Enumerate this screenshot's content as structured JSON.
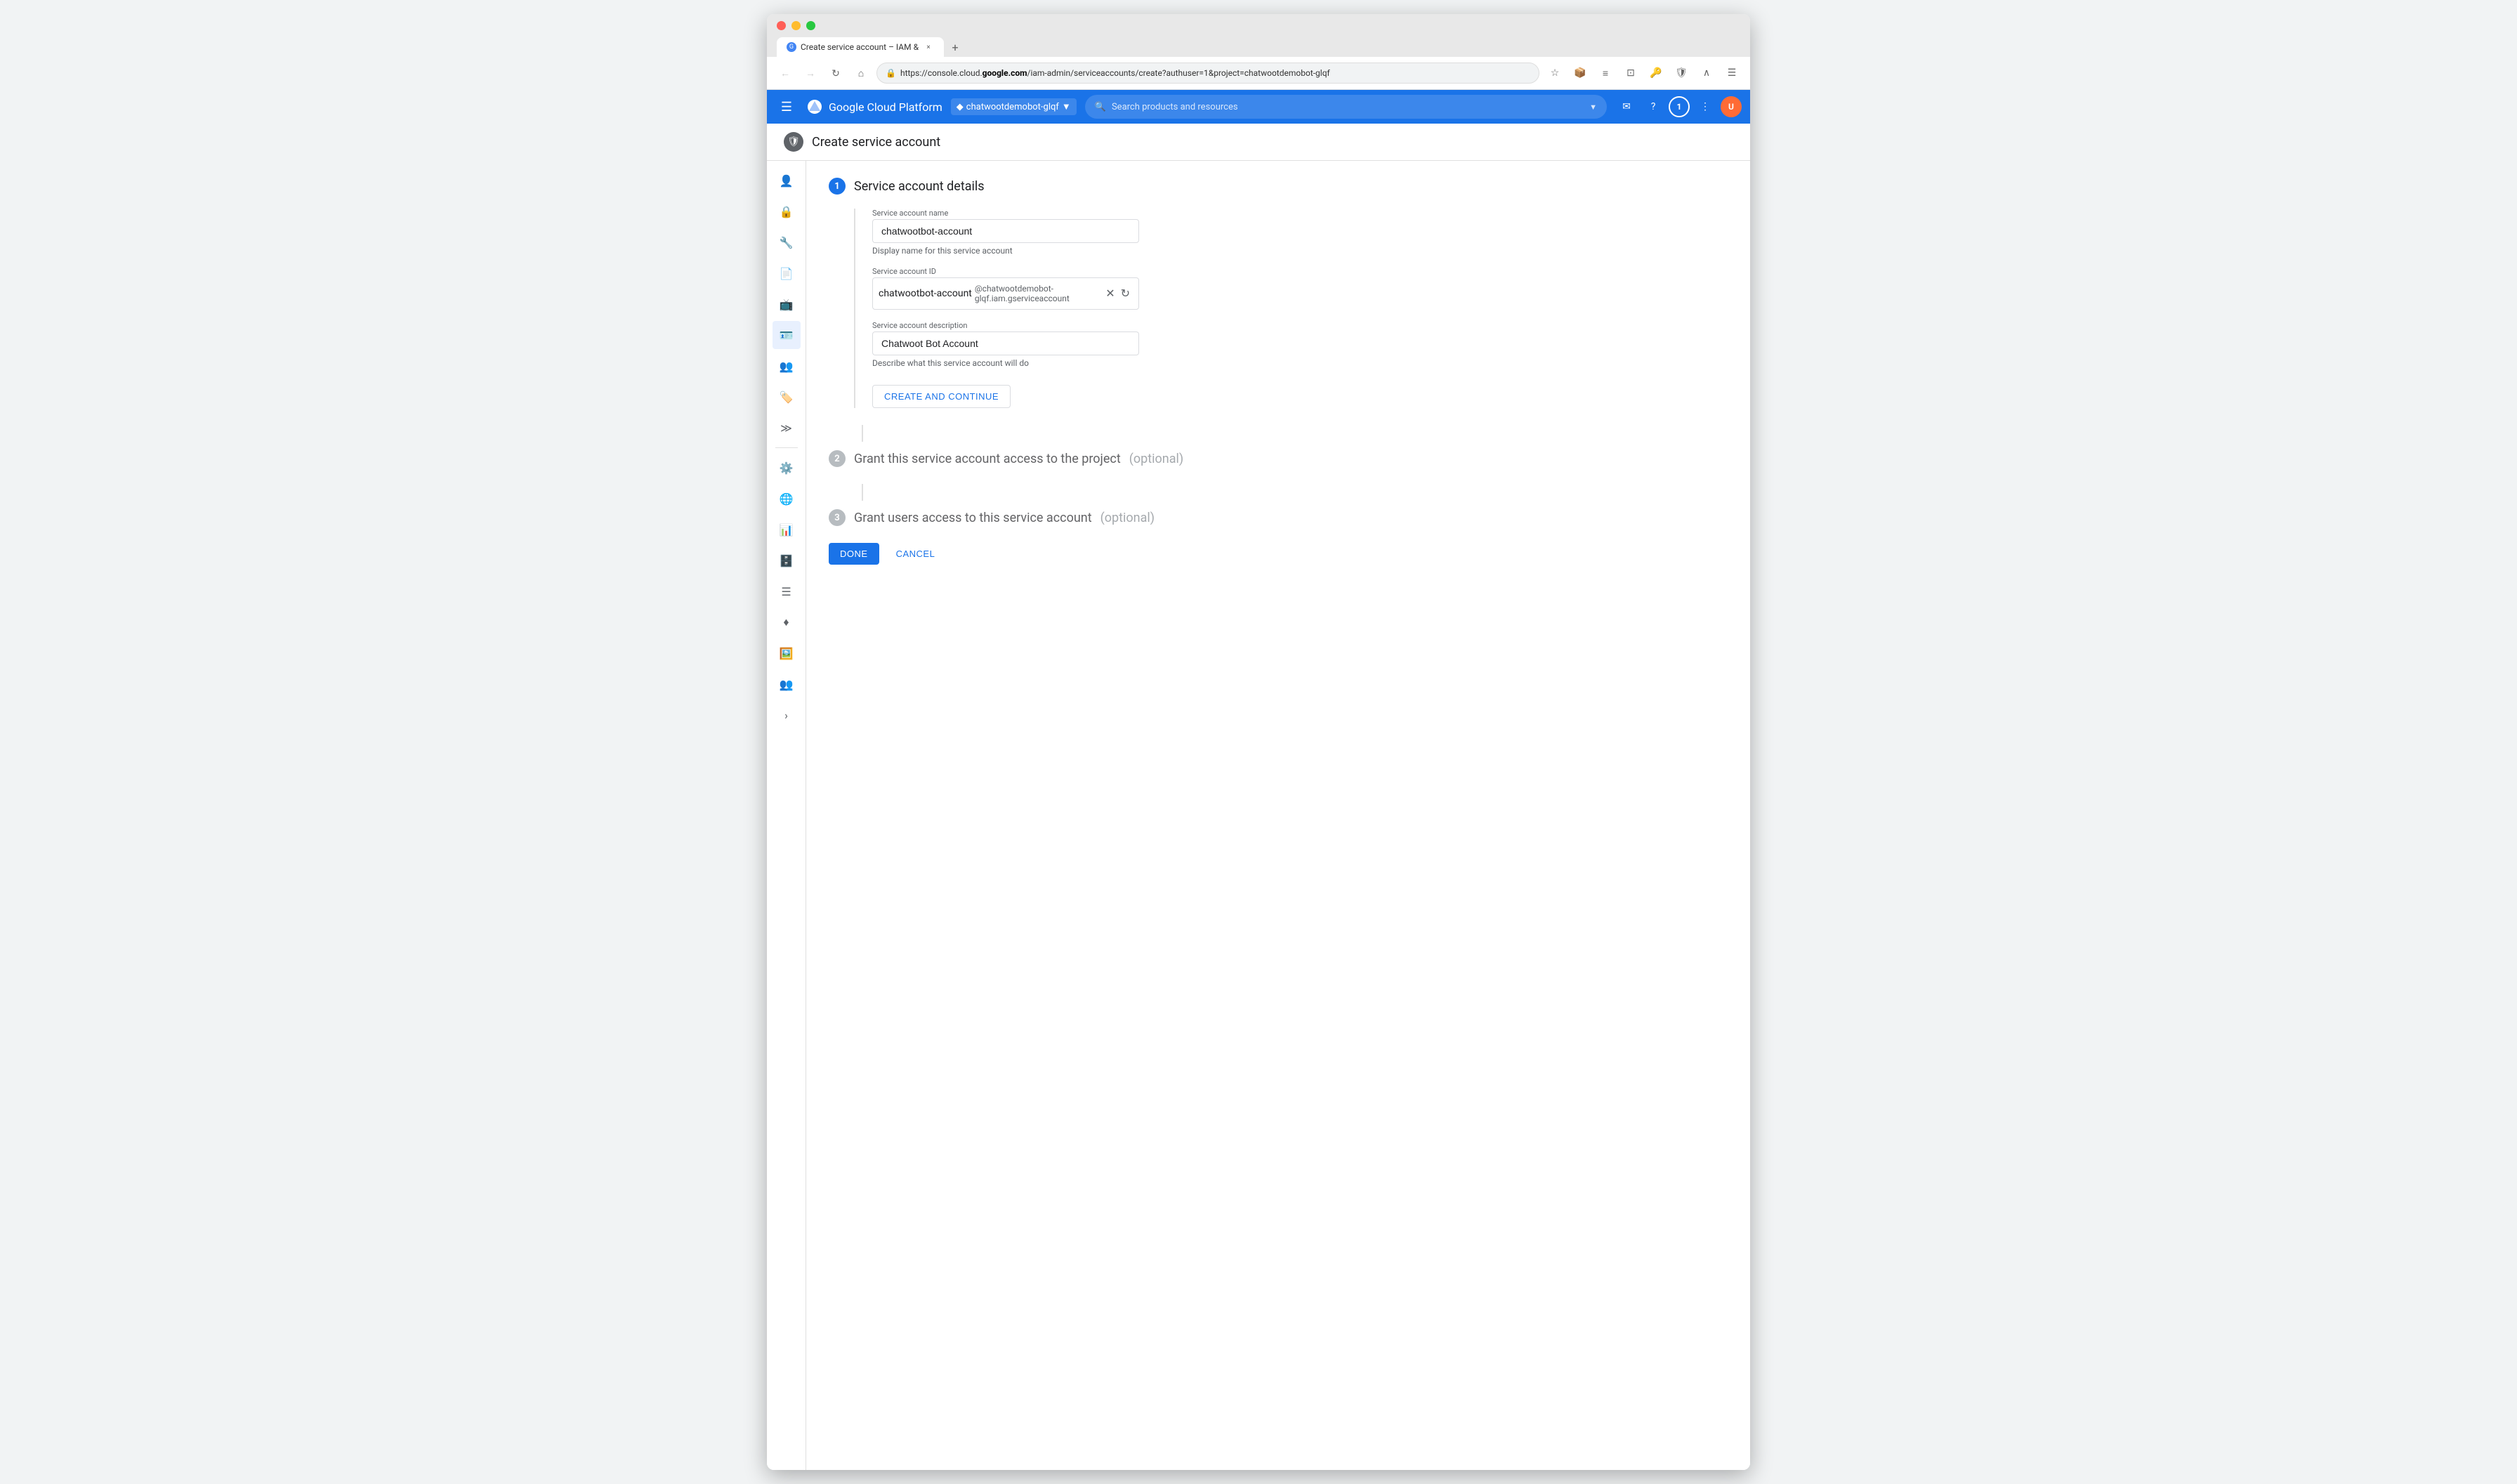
{
  "browser": {
    "tab_title": "Create service account – IAM &",
    "tab_close": "×",
    "tab_new": "+",
    "url_display": "https://console.cloud.google.com/iam-admin/serviceaccounts/create?authuser=1&project=chatwootdemobot-glqf",
    "url_host": "console.cloud.",
    "url_host_bold": "google.com",
    "url_rest": "/iam-admin/serviceaccounts/create?authuser=1&project=chatwootdemobot-glqf"
  },
  "topnav": {
    "logo_text": "Google Cloud Platform",
    "project_name": "chatwootdemobot-glqf",
    "search_placeholder": "Search products and resources"
  },
  "page_header": {
    "title": "Create service account"
  },
  "step1": {
    "number": "1",
    "title": "Service account details",
    "name_label": "Service account name",
    "name_value": "chatwootbot-account",
    "name_hint": "Display name for this service account",
    "id_label": "Service account ID",
    "id_prefix": "chatwootbot-account",
    "id_suffix": "@chatwootdemobot-glqf.iam.gserviceaccount",
    "desc_label": "Service account description",
    "desc_value": "Chatwoot Bot Account",
    "desc_hint": "Describe what this service account will do",
    "create_button": "CREATE AND CONTINUE"
  },
  "step2": {
    "number": "2",
    "title": "Grant this service account access to the project",
    "subtitle": "(optional)"
  },
  "step3": {
    "number": "3",
    "title": "Grant users access to this service account",
    "subtitle": "(optional)"
  },
  "bottom_buttons": {
    "done": "DONE",
    "cancel": "CANCEL"
  },
  "sidebar": {
    "icons": [
      {
        "name": "person-icon",
        "symbol": "👤"
      },
      {
        "name": "security-icon",
        "symbol": "🔒"
      },
      {
        "name": "tools-icon",
        "symbol": "🔧"
      },
      {
        "name": "document-icon",
        "symbol": "📄"
      },
      {
        "name": "monitor-icon",
        "symbol": "📺"
      },
      {
        "name": "iam-icon",
        "symbol": "🪪",
        "active": true
      },
      {
        "name": "group-icon",
        "symbol": "👥"
      },
      {
        "name": "tag-icon",
        "symbol": "🏷️"
      },
      {
        "name": "more-icon",
        "symbol": "≫"
      },
      {
        "name": "settings-icon",
        "symbol": "⚙️"
      },
      {
        "name": "globe-icon",
        "symbol": "🌐"
      },
      {
        "name": "table-icon",
        "symbol": "📊"
      },
      {
        "name": "db-icon",
        "symbol": "🗄️"
      },
      {
        "name": "list-icon",
        "symbol": "☰"
      },
      {
        "name": "diamond-icon",
        "symbol": "♦️"
      },
      {
        "name": "image-icon",
        "symbol": "🖼️"
      },
      {
        "name": "people-icon",
        "symbol": "👥"
      },
      {
        "name": "expand-icon",
        "symbol": "›"
      }
    ]
  }
}
